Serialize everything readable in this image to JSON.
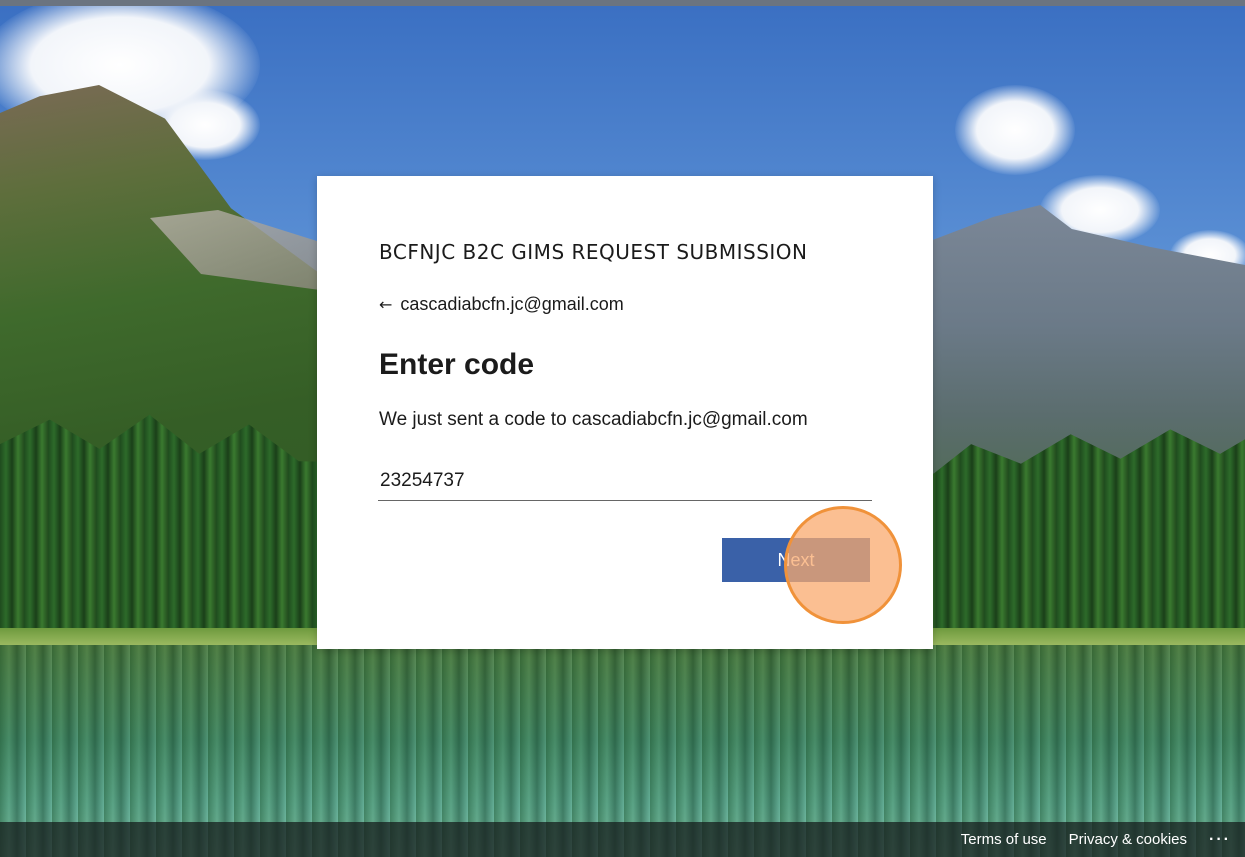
{
  "card": {
    "org_title": "BCFNJC B2C GIMS REQUEST SUBMISSION",
    "back_arrow_icon": "arrow-left",
    "back_arrow_glyph": "←",
    "email": "cascadiabcfn.jc@gmail.com",
    "heading": "Enter code",
    "description": "We just sent a code to cascadiabcfn.jc@gmail.com",
    "code_value": "23254737",
    "next_label": "Next"
  },
  "footer": {
    "terms": "Terms of use",
    "privacy": "Privacy & cookies",
    "more": "···"
  },
  "colors": {
    "button": "#3a61a8",
    "click_highlight": "#f0923a"
  }
}
